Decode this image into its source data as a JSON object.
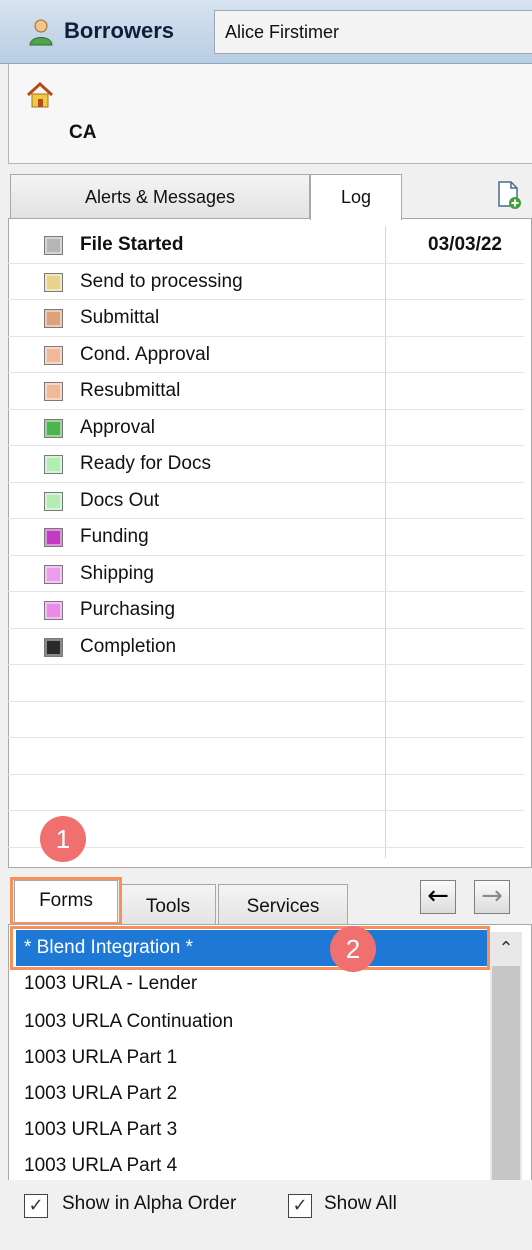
{
  "header": {
    "title": "Borrowers",
    "borrower_name": "Alice Firstimer"
  },
  "address": {
    "state": "CA"
  },
  "upper_tabs": [
    {
      "label": "Alerts & Messages",
      "active": false
    },
    {
      "label": "Log",
      "active": true
    }
  ],
  "log": {
    "items": [
      {
        "label": "File Started",
        "date": "03/03/22",
        "color": "#b5b5b5",
        "bold": true
      },
      {
        "label": "Send to processing",
        "color": "#ead38c"
      },
      {
        "label": "Submittal",
        "color": "#dea17a"
      },
      {
        "label": "Cond. Approval",
        "color": "#f0b99a"
      },
      {
        "label": "Resubmittal",
        "color": "#f0b99a"
      },
      {
        "label": "Approval",
        "color": "#4bb54b"
      },
      {
        "label": "Ready for Docs",
        "color": "#b4edb4"
      },
      {
        "label": "Docs Out",
        "color": "#b4edb4"
      },
      {
        "label": "Funding",
        "color": "#c03cc0"
      },
      {
        "label": "Shipping",
        "color": "#ec9cec"
      },
      {
        "label": "Purchasing",
        "color": "#e88ce8"
      },
      {
        "label": "Completion",
        "color": "#2a2a2a"
      }
    ]
  },
  "callouts": {
    "one": "1",
    "two": "2"
  },
  "lower_tabs": [
    {
      "label": "Forms",
      "active": true
    },
    {
      "label": "Tools",
      "active": false
    },
    {
      "label": "Services",
      "active": false
    }
  ],
  "forms": {
    "items": [
      {
        "label": "* Blend Integration *",
        "selected": true
      },
      {
        "label": "1003 URLA - Lender"
      },
      {
        "label": "1003 URLA Continuation"
      },
      {
        "label": "1003 URLA Part 1"
      },
      {
        "label": "1003 URLA Part 2"
      },
      {
        "label": "1003 URLA Part 3"
      },
      {
        "label": "1003 URLA Part 4"
      }
    ]
  },
  "options": {
    "alpha_order_label": "Show in Alpha Order",
    "alpha_order_checked": true,
    "show_all_label": "Show All",
    "show_all_checked": true
  },
  "colors": {
    "selection": "#1e78d6",
    "callout": "#f07070",
    "highlight": "#f5915a"
  }
}
